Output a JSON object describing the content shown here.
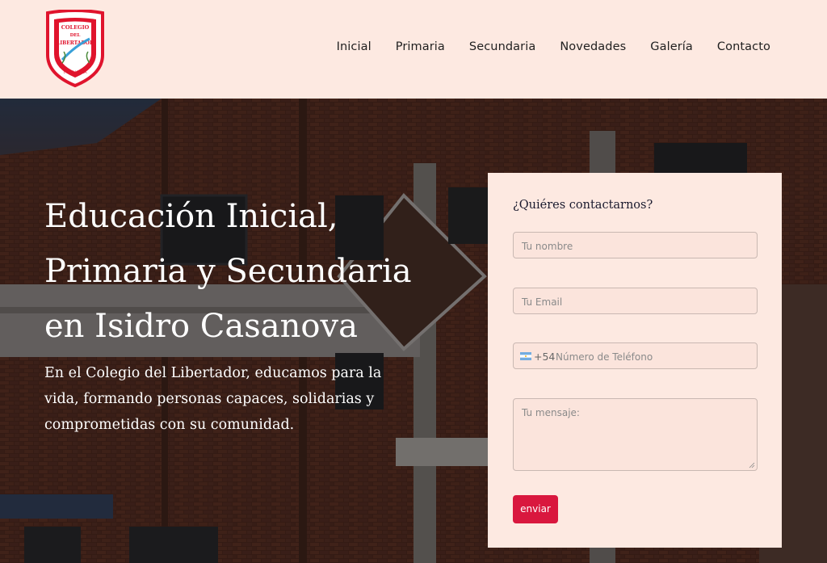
{
  "logo": {
    "top_text": "COLEGIO",
    "mid_text": "DEL",
    "main_text": "LIBERTADOR",
    "bottom_text": "I. CASANOVA"
  },
  "nav": {
    "items": [
      "Inicial",
      "Primaria",
      "Secundaria",
      "Novedades",
      "Galería",
      "Contacto"
    ]
  },
  "hero": {
    "title_lines": [
      "Educación Inicial,",
      "Primaria y Secundaria",
      "en Isidro Casanova"
    ],
    "subtitle": "En el Colegio del Libertador, educamos para la vida, formando personas capaces, solidarias y comprometidas con su comunidad."
  },
  "form": {
    "title": "¿Quiéres contactarnos?",
    "name_placeholder": "Tu nombre",
    "email_placeholder": "Tu Email",
    "phone_code": "+54",
    "phone_placeholder": "Número de Teléfono",
    "message_placeholder": "Tu mensaje:",
    "submit_label": "enviar"
  },
  "colors": {
    "header_bg": "#fde9e1",
    "accent": "#d9173e",
    "brick": "#6b3a2a"
  }
}
